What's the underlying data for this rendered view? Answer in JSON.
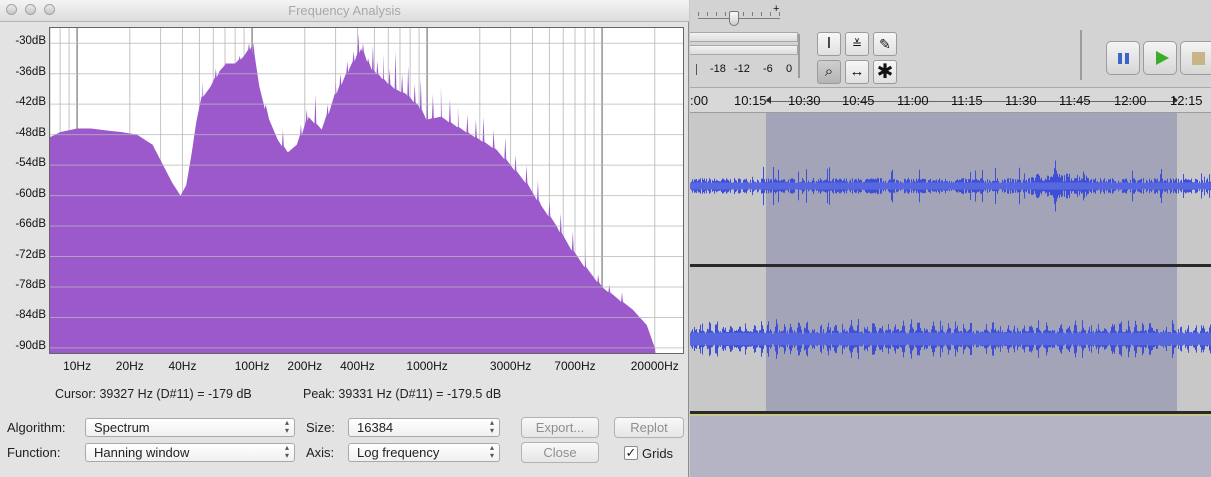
{
  "window": {
    "title": "Frequency Analysis"
  },
  "plot": {
    "y_labels": [
      "-30dB",
      "-36dB",
      "-42dB",
      "-48dB",
      "-54dB",
      "-60dB",
      "-66dB",
      "-72dB",
      "-78dB",
      "-84dB",
      "-90dB"
    ],
    "x_labels": [
      "10Hz",
      "20Hz",
      "40Hz",
      "100Hz",
      "200Hz",
      "400Hz",
      "1000Hz",
      "3000Hz",
      "7000Hz",
      "20000Hz"
    ],
    "fill_color": "#9b59cc"
  },
  "chart_data": {
    "type": "area",
    "x_axis_scale": "log",
    "x_range_hz": [
      7,
      29000
    ],
    "y_range_db": [
      -91,
      -27
    ],
    "grid": true,
    "envelope": [
      {
        "hz": 7,
        "db": -48.5
      },
      {
        "hz": 8,
        "db": -47.5
      },
      {
        "hz": 10,
        "db": -46.8
      },
      {
        "hz": 12,
        "db": -46.8
      },
      {
        "hz": 15,
        "db": -47.2
      },
      {
        "hz": 18,
        "db": -47.5
      },
      {
        "hz": 22,
        "db": -48.0
      },
      {
        "hz": 27,
        "db": -50.0
      },
      {
        "hz": 31,
        "db": -54.0
      },
      {
        "hz": 35,
        "db": -57.5
      },
      {
        "hz": 39,
        "db": -60.0
      },
      {
        "hz": 42,
        "db": -58.0
      },
      {
        "hz": 45,
        "db": -52.0
      },
      {
        "hz": 48,
        "db": -45.5
      },
      {
        "hz": 52,
        "db": -40.5
      },
      {
        "hz": 58,
        "db": -38.5
      },
      {
        "hz": 65,
        "db": -35.5
      },
      {
        "hz": 72,
        "db": -34.0
      },
      {
        "hz": 80,
        "db": -34.0
      },
      {
        "hz": 90,
        "db": -32.5
      },
      {
        "hz": 100,
        "db": -30.5
      },
      {
        "hz": 110,
        "db": -38.5
      },
      {
        "hz": 125,
        "db": -45.0
      },
      {
        "hz": 140,
        "db": -49.0
      },
      {
        "hz": 160,
        "db": -51.5
      },
      {
        "hz": 180,
        "db": -50.0
      },
      {
        "hz": 210,
        "db": -44.5
      },
      {
        "hz": 250,
        "db": -47.0
      },
      {
        "hz": 300,
        "db": -40.0
      },
      {
        "hz": 360,
        "db": -35.0
      },
      {
        "hz": 420,
        "db": -31.0
      },
      {
        "hz": 480,
        "db": -35.0
      },
      {
        "hz": 560,
        "db": -37.0
      },
      {
        "hz": 650,
        "db": -39.0
      },
      {
        "hz": 760,
        "db": -40.0
      },
      {
        "hz": 900,
        "db": -42.5
      },
      {
        "hz": 1000,
        "db": -45.0
      },
      {
        "hz": 1200,
        "db": -44.5
      },
      {
        "hz": 1500,
        "db": -46.5
      },
      {
        "hz": 2000,
        "db": -49.0
      },
      {
        "hz": 2500,
        "db": -51.0
      },
      {
        "hz": 3000,
        "db": -54.0
      },
      {
        "hz": 3800,
        "db": -58.0
      },
      {
        "hz": 4500,
        "db": -62.0
      },
      {
        "hz": 5500,
        "db": -66.0
      },
      {
        "hz": 6500,
        "db": -70.0
      },
      {
        "hz": 8000,
        "db": -74.0
      },
      {
        "hz": 10000,
        "db": -78.0
      },
      {
        "hz": 12500,
        "db": -80.5
      },
      {
        "hz": 15000,
        "db": -82.5
      },
      {
        "hz": 18000,
        "db": -85.5
      },
      {
        "hz": 20000,
        "db": -90.0
      },
      {
        "hz": 20200,
        "db": -91.0
      }
    ],
    "peaks": [
      {
        "hz": 52,
        "db": -37.5
      },
      {
        "hz": 62,
        "db": -35.0
      },
      {
        "hz": 71,
        "db": -33.8
      },
      {
        "hz": 85,
        "db": -32.5
      },
      {
        "hz": 96,
        "db": -30.0
      },
      {
        "hz": 102,
        "db": -29.8
      },
      {
        "hz": 118,
        "db": -43.0
      },
      {
        "hz": 150,
        "db": -47.0
      },
      {
        "hz": 190,
        "db": -46.0
      },
      {
        "hz": 205,
        "db": -43.0
      },
      {
        "hz": 230,
        "db": -40.0
      },
      {
        "hz": 270,
        "db": -42.0
      },
      {
        "hz": 300,
        "db": -37.5
      },
      {
        "hz": 320,
        "db": -36.0
      },
      {
        "hz": 350,
        "db": -33.5
      },
      {
        "hz": 380,
        "db": -31.5
      },
      {
        "hz": 405,
        "db": -28.0
      },
      {
        "hz": 430,
        "db": -30.0
      },
      {
        "hz": 460,
        "db": -33.0
      },
      {
        "hz": 490,
        "db": -30.5
      },
      {
        "hz": 520,
        "db": -33.5
      },
      {
        "hz": 560,
        "db": -32.0
      },
      {
        "hz": 610,
        "db": -35.0
      },
      {
        "hz": 660,
        "db": -31.5
      },
      {
        "hz": 720,
        "db": -36.0
      },
      {
        "hz": 780,
        "db": -34.5
      },
      {
        "hz": 850,
        "db": -38.0
      },
      {
        "hz": 920,
        "db": -37.0
      },
      {
        "hz": 1000,
        "db": -39.0
      },
      {
        "hz": 1080,
        "db": -40.0
      },
      {
        "hz": 1200,
        "db": -38.5
      },
      {
        "hz": 1350,
        "db": -41.0
      },
      {
        "hz": 1500,
        "db": -42.5
      },
      {
        "hz": 1700,
        "db": -44.0
      },
      {
        "hz": 1900,
        "db": -45.0
      },
      {
        "hz": 2100,
        "db": -44.5
      },
      {
        "hz": 2400,
        "db": -47.0
      },
      {
        "hz": 2800,
        "db": -48.5
      },
      {
        "hz": 3200,
        "db": -52.0
      },
      {
        "hz": 3700,
        "db": -54.0
      },
      {
        "hz": 4300,
        "db": -57.0
      },
      {
        "hz": 5000,
        "db": -61.0
      },
      {
        "hz": 5800,
        "db": -63.5
      },
      {
        "hz": 6800,
        "db": -67.0
      },
      {
        "hz": 8000,
        "db": -71.0
      },
      {
        "hz": 9500,
        "db": -75.5
      },
      {
        "hz": 11000,
        "db": -77.5
      },
      {
        "hz": 13000,
        "db": -79.0
      }
    ]
  },
  "readout": {
    "cursor": "Cursor: 39327 Hz (D#11) = -179 dB",
    "peak": "Peak: 39331 Hz (D#11) = -179.5 dB"
  },
  "controls": {
    "algorithm_label": "Algorithm:",
    "algorithm_value": "Spectrum",
    "function_label": "Function:",
    "function_value": "Hanning window",
    "size_label": "Size:",
    "size_value": "16384",
    "axis_label": "Axis:",
    "axis_value": "Log frequency",
    "export": "Export...",
    "replot": "Replot",
    "close": "Close",
    "grids": "Grids",
    "grids_checked": true
  },
  "toolbar": {
    "slider_plus": "+",
    "meter_labels": [
      "-18",
      "-12",
      "-6",
      "0"
    ]
  },
  "timeline": {
    "labels": [
      ":00",
      "10:15",
      "10:30",
      "10:45",
      "11:00",
      "11:15",
      "11:30",
      "11:45",
      "12:00",
      "12:15"
    ]
  },
  "colors": {
    "waveform": "#3c4fd6",
    "selection": "#a3a4b7",
    "track_bg": "#c8c8c8",
    "play_green": "#3aab2a",
    "pause_blue": "#3b66c9"
  }
}
